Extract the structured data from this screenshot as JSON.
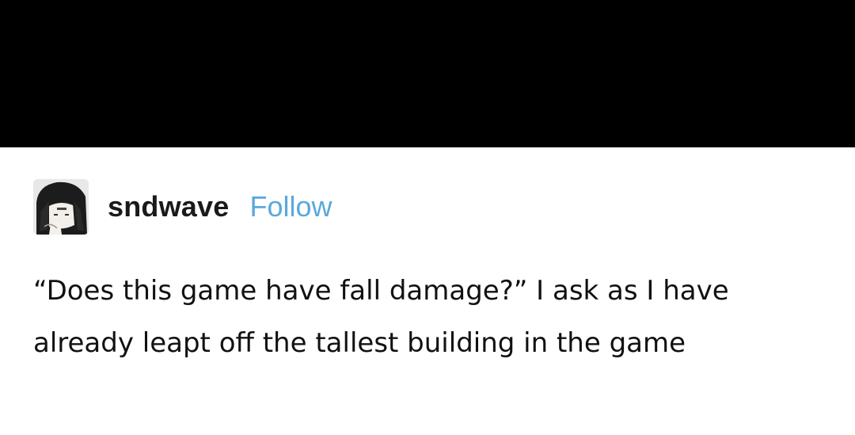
{
  "colors": {
    "top_bar": "#000000",
    "background": "#ffffff",
    "follow_link": "#5aa8dc",
    "text": "#111111"
  },
  "post": {
    "avatar_icon": "anime-character-avatar-icon",
    "username": "sndwave",
    "follow_label": "Follow",
    "text": "“Does this game have fall damage?” I ask as I have already leapt off the tallest building in the game"
  }
}
